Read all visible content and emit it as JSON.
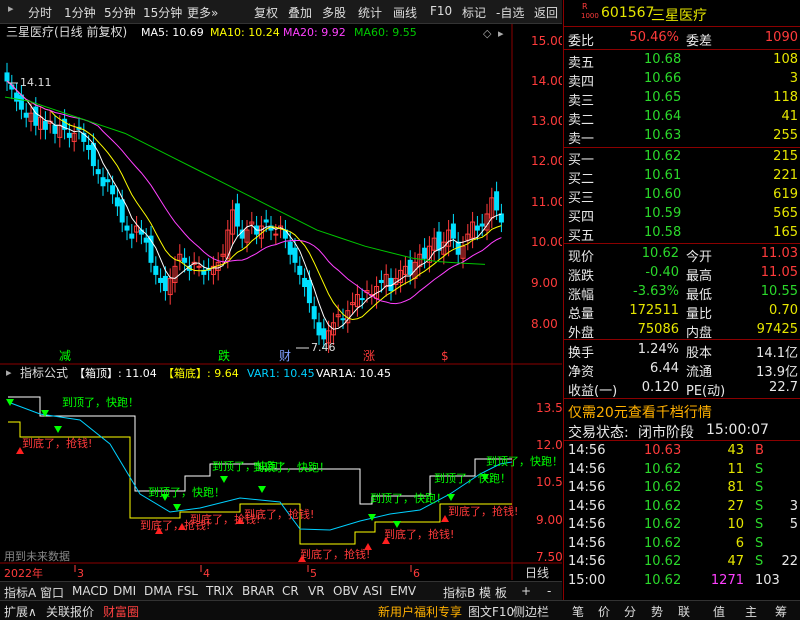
{
  "toolbar": {
    "items": [
      "分时",
      "1分钟",
      "5分钟",
      "15分钟",
      "更多»",
      "复权",
      "叠加",
      "多股",
      "统计",
      "画线",
      "F10",
      "标记",
      "-自选",
      "返回"
    ]
  },
  "main_chart": {
    "title": "三星医疗(日线 前复权)",
    "indicators": [
      {
        "label": "MA5: 10.69",
        "color": "#ffffff"
      },
      {
        "label": "MA10: 10.24",
        "color": "#ffff00"
      },
      {
        "label": "MA20: 9.92",
        "color": "#ff40ff"
      },
      {
        "label": "MA60: 9.55",
        "color": "#00c800"
      }
    ],
    "y_ticks": [
      "15.00",
      "14.00",
      "13.00",
      "12.00",
      "11.00",
      "10.00",
      "9.00",
      "8.00"
    ],
    "high_label": "14.11",
    "low_label": "7.46",
    "markers": [
      {
        "text": "减",
        "color": "#00ff00"
      },
      {
        "text": "跌",
        "color": "#00ff00"
      },
      {
        "text": "财",
        "color": "#80a0ff"
      },
      {
        "text": "涨",
        "color": "#ff3b3b"
      },
      {
        "text": "$",
        "color": "#ff3b3b"
      }
    ]
  },
  "sub_chart": {
    "name": "指标公式",
    "labels": [
      {
        "text": "【箱顶】: 11.04",
        "color": "#ffffff"
      },
      {
        "text": "【箱底】: 9.64",
        "color": "#ffff00"
      },
      {
        "text": "VAR1: 10.45",
        "color": "#00d0ff"
      },
      {
        "text": "VAR1A: 10.45",
        "color": "#ffffff"
      }
    ],
    "y_ticks": [
      "13.50",
      "12.00",
      "10.50",
      "9.00",
      "7.50"
    ],
    "top_text": "到顶了，快跑！",
    "bottom_text": "到底了，抢钱!",
    "note": "用到未来数据"
  },
  "x_axis": {
    "labels": [
      "2022年",
      "3",
      "4",
      "5",
      "6"
    ],
    "right_label": "日线"
  },
  "bottom_tabs": [
    "指标A",
    "窗口",
    "MACD",
    "DMI",
    "DMA",
    "FSL",
    "TRIX",
    "BRAR",
    "CR",
    "VR",
    "OBV",
    "ASI",
    "EMV",
    "指标B",
    "模",
    "板",
    "+",
    "-"
  ],
  "status_bar": {
    "left": [
      "扩展∧",
      "关联报价",
      "财富圈"
    ],
    "middle": "新用户福利专享",
    "right": [
      "图文F10",
      "侧边栏",
      "笔",
      "价",
      "分",
      "势",
      "联",
      "值",
      "主",
      "筹"
    ]
  },
  "quote": {
    "code": "601567",
    "name": "三星医疗",
    "code_prefix_top": "R",
    "code_prefix_bottom": "1000",
    "ratio_label": "委比",
    "ratio": "50.46%",
    "diff_label": "委差",
    "diff": "1090",
    "asks": [
      {
        "label": "卖五",
        "price": "10.68",
        "vol": "108"
      },
      {
        "label": "卖四",
        "price": "10.66",
        "vol": "3"
      },
      {
        "label": "卖三",
        "price": "10.65",
        "vol": "118"
      },
      {
        "label": "卖二",
        "price": "10.64",
        "vol": "41"
      },
      {
        "label": "卖一",
        "price": "10.63",
        "vol": "255"
      }
    ],
    "bids": [
      {
        "label": "买一",
        "price": "10.62",
        "vol": "215"
      },
      {
        "label": "买二",
        "price": "10.61",
        "vol": "221"
      },
      {
        "label": "买三",
        "price": "10.60",
        "vol": "619"
      },
      {
        "label": "买四",
        "price": "10.59",
        "vol": "565"
      },
      {
        "label": "买五",
        "price": "10.58",
        "vol": "165"
      }
    ],
    "stats": [
      {
        "l1": "现价",
        "v1": "10.62",
        "l2": "今开",
        "v2": "11.03"
      },
      {
        "l1": "涨跌",
        "v1": "-0.40",
        "l2": "最高",
        "v2": "11.05"
      },
      {
        "l1": "涨幅",
        "v1": "-3.63%",
        "l2": "最低",
        "v2": "10.55"
      },
      {
        "l1": "总量",
        "v1": "172511",
        "l2": "量比",
        "v2": "0.70"
      },
      {
        "l1": "外盘",
        "v1": "75086",
        "l2": "内盘",
        "v2": "97425"
      }
    ],
    "stats2": [
      {
        "l1": "换手",
        "v1": "1.24%",
        "l2": "股本",
        "v2": "14.1亿"
      },
      {
        "l1": "净资",
        "v1": "6.44",
        "l2": "流通",
        "v2": "13.9亿"
      },
      {
        "l1": "收益(一)",
        "v1": "0.120",
        "l2": "PE(动)",
        "v2": "22.7"
      }
    ],
    "promo": "仅需20元查看千档行情",
    "trade_state_label": "交易状态:",
    "trade_state": "闭市阶段",
    "trade_time": "15:00:07",
    "ticks": [
      {
        "t": "14:56",
        "p": "10.63",
        "v": "43",
        "f": "B"
      },
      {
        "t": "14:56",
        "p": "10.62",
        "v": "11",
        "f": "S"
      },
      {
        "t": "14:56",
        "p": "10.62",
        "v": "81",
        "f": "S"
      },
      {
        "t": "14:56",
        "p": "10.62",
        "v": "27",
        "f": "S"
      },
      {
        "t": "14:56",
        "p": "10.62",
        "v": "10",
        "f": "S"
      },
      {
        "t": "14:56",
        "p": "10.62",
        "v": "6",
        "f": "S"
      },
      {
        "t": "14:56",
        "p": "10.62",
        "v": "47",
        "f": "S"
      },
      {
        "t": "15:00",
        "p": "10.62",
        "v": "1271",
        "f": "103"
      }
    ],
    "tick_extra": [
      "3",
      "5",
      "22"
    ]
  }
}
